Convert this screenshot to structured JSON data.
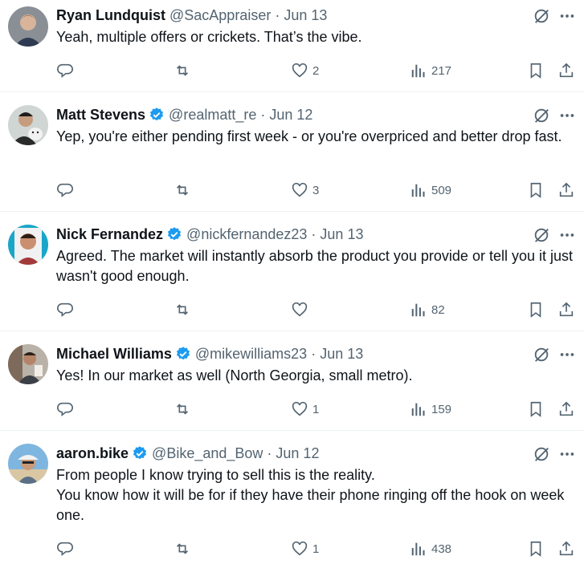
{
  "tweets": [
    {
      "name": "Ryan Lundquist",
      "verified": false,
      "handle": "@SacAppraiser",
      "date": "Jun 13",
      "lines": [
        "Yeah, multiple offers or crickets. That’s the vibe."
      ],
      "replies": "",
      "retweets": "",
      "likes": "2",
      "views": "217"
    },
    {
      "name": "Matt Stevens",
      "verified": true,
      "handle": "@realmatt_re",
      "date": "Jun 12",
      "lines": [
        "Yep, you're either pending first week - or you're overpriced and better drop fast."
      ],
      "replies": "",
      "retweets": "",
      "likes": "3",
      "views": "509"
    },
    {
      "name": "Nick Fernandez",
      "verified": true,
      "handle": "@nickfernandez23",
      "date": "Jun 13",
      "lines": [
        "Agreed. The market will instantly absorb the product you provide or tell you it just wasn't good enough."
      ],
      "replies": "",
      "retweets": "",
      "likes": "",
      "views": "82"
    },
    {
      "name": "Michael Williams",
      "verified": true,
      "handle": "@mikewilliams23",
      "date": "Jun 13",
      "lines": [
        "Yes! In our market as well (North Georgia, small metro)."
      ],
      "replies": "",
      "retweets": "",
      "likes": "1",
      "views": "159"
    },
    {
      "name": "aaron.bike",
      "verified": true,
      "handle": "@Bike_and_Bow",
      "date": "Jun 12",
      "lines": [
        "From people I know trying to sell this is the reality.",
        "You know how it will be for if they have their phone ringing off the hook on week one."
      ],
      "replies": "",
      "retweets": "",
      "likes": "1",
      "views": "438"
    }
  ],
  "separator": "·",
  "colors": {
    "text": "#0f1419",
    "muted": "#536471",
    "verified": "#1d9bf0",
    "border": "#eff3f4"
  },
  "icons": [
    "reply-icon",
    "retweet-icon",
    "like-icon",
    "views-icon",
    "bookmark-icon",
    "share-icon",
    "grok-icon",
    "more-icon",
    "verified-badge-icon"
  ]
}
